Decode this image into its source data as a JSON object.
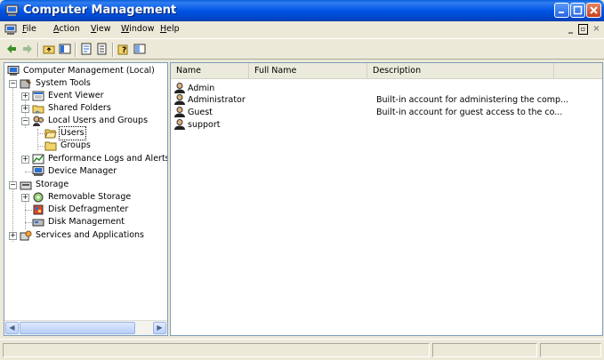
{
  "window": {
    "title": "Computer Management"
  },
  "menu": [
    {
      "label": "File",
      "key": "F",
      "rest": "ile"
    },
    {
      "label": "Action",
      "key": "A",
      "rest": "ction"
    },
    {
      "label": "View",
      "key": "V",
      "rest": "iew"
    },
    {
      "label": "Window",
      "key": "W",
      "rest": "indow"
    },
    {
      "label": "Help",
      "key": "H",
      "rest": "elp"
    }
  ],
  "toolbar": {
    "buttons": [
      "back-arrow-icon",
      "forward-arrow-icon",
      "up-folder-icon",
      "show-hide-tree-icon",
      "properties-icon",
      "export-list-icon",
      "help-icon",
      "mmc-icon"
    ]
  },
  "tree": {
    "root": "Computer Management (Local)",
    "system_tools": "System Tools",
    "event_viewer": "Event Viewer",
    "shared_folders": "Shared Folders",
    "local_users_groups": "Local Users and Groups",
    "users": "Users",
    "groups": "Groups",
    "perf_logs": "Performance Logs and Alerts",
    "device_manager": "Device Manager",
    "storage": "Storage",
    "removable_storage": "Removable Storage",
    "disk_defrag": "Disk Defragmenter",
    "disk_mgmt": "Disk Management",
    "services_apps": "Services and Applications"
  },
  "list": {
    "columns": [
      "Name",
      "Full Name",
      "Description"
    ],
    "rows": [
      {
        "name": "Admin",
        "full_name": "",
        "description": ""
      },
      {
        "name": "Administrator",
        "full_name": "",
        "description": "Built-in account for administering the comp..."
      },
      {
        "name": "Guest",
        "full_name": "",
        "description": "Built-in account for guest access to the co..."
      },
      {
        "name": "support",
        "full_name": "",
        "description": ""
      }
    ]
  },
  "colors": {
    "titlebar": "#0055e5",
    "window_bg": "#ece9d8",
    "pane_border": "#7f9db9"
  }
}
